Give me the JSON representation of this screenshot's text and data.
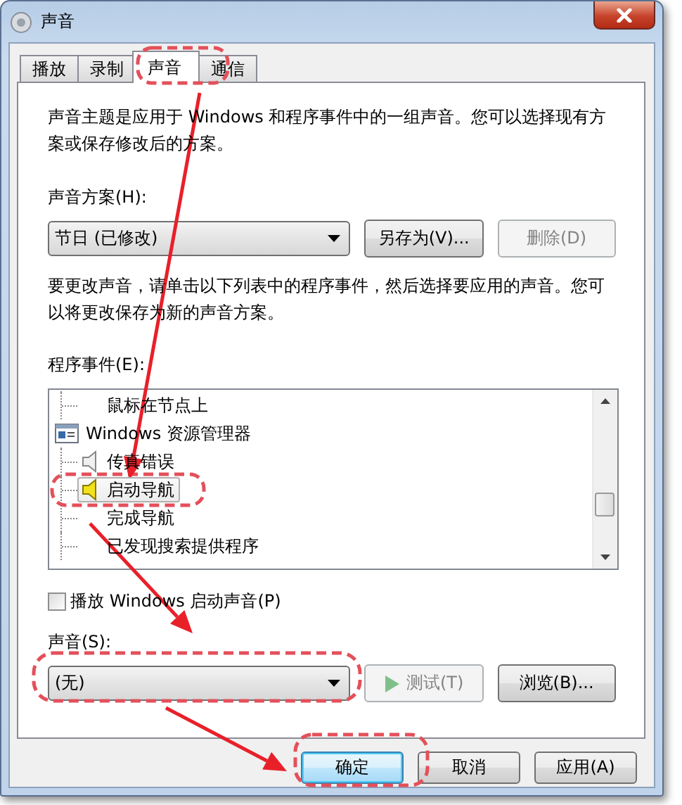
{
  "window": {
    "title": "声音"
  },
  "tabs": [
    {
      "label": "播放",
      "selected": false
    },
    {
      "label": "录制",
      "selected": false
    },
    {
      "label": "声音",
      "selected": true
    },
    {
      "label": "通信",
      "selected": false
    }
  ],
  "description": "声音主题是应用于 Windows 和程序事件中的一组声音。您可以选择现有方案或保存修改后的方案。",
  "scheme": {
    "label": "声音方案(H):",
    "value": "节日 (已修改)",
    "buttons": [
      {
        "label": "另存为(V)...",
        "disabled": false
      },
      {
        "label": "删除(D)",
        "disabled": true
      }
    ]
  },
  "instruction": "要更改声音，请单击以下列表中的程序事件，然后选择要应用的声音。您可以将更改保存为新的声音方案。",
  "events": {
    "label": "程序事件(E):",
    "items": [
      {
        "kind": "group",
        "children": [
          {
            "kind": "event",
            "label": "鼠标在节点上",
            "has_sound": false,
            "selected": false
          }
        ]
      },
      {
        "kind": "group",
        "label": "Windows 资源管理器",
        "children": [
          {
            "kind": "event",
            "label": "传真错误",
            "has_sound": true,
            "selected": false
          },
          {
            "kind": "event",
            "label": "启动导航",
            "has_sound": true,
            "selected": true
          },
          {
            "kind": "event",
            "label": "完成导航",
            "has_sound": false,
            "selected": false
          },
          {
            "kind": "event",
            "label": "已发现搜索提供程序",
            "has_sound": false,
            "selected": false
          }
        ]
      }
    ]
  },
  "startup_checkbox": {
    "label": "播放 Windows 启动声音(P)",
    "checked": false
  },
  "sound": {
    "label": "声音(S):",
    "value": "(无)",
    "buttons": [
      {
        "kind": "play",
        "label": "测试(T)",
        "disabled": true
      },
      {
        "kind": "plain",
        "label": "浏览(B)...",
        "disabled": false
      }
    ]
  },
  "footer_buttons": [
    {
      "label": "确定",
      "default": true,
      "disabled": false
    },
    {
      "label": "取消",
      "default": false,
      "disabled": false
    },
    {
      "label": "应用(A)",
      "default": false,
      "disabled": false
    }
  ],
  "annotations": [
    {
      "kind": "ellipse"
    },
    {
      "kind": "ellipse"
    },
    {
      "kind": "ellipse"
    },
    {
      "kind": "ellipse"
    },
    {
      "kind": "arrow"
    },
    {
      "kind": "arrow"
    },
    {
      "kind": "arrow"
    }
  ]
}
